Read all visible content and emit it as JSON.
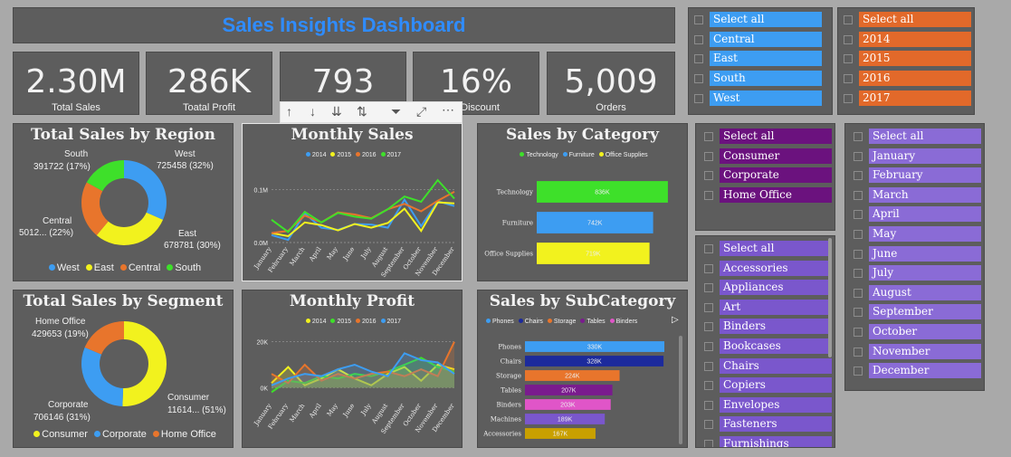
{
  "dashboard_title": "Sales Insights Dashboard",
  "kpis": [
    {
      "value": "2.30M",
      "label": "Total Sales"
    },
    {
      "value": "286K",
      "label": "Toatal Profit"
    },
    {
      "value": "793",
      "label": "s"
    },
    {
      "value": "16%",
      "label": "g Discount"
    },
    {
      "value": "5,009",
      "label": "Orders"
    }
  ],
  "toolbar": {
    "icons": [
      "arrow-up-icon",
      "arrow-down-icon",
      "double-arrow-down-icon",
      "expand-hierarchy-icon",
      "filter-icon",
      "focus-mode-icon",
      "more-options-icon"
    ]
  },
  "slicers": {
    "region": {
      "color": "#3d9df2",
      "items": [
        "Select all",
        "Central",
        "East",
        "South",
        "West"
      ]
    },
    "year": {
      "color": "#e2692a",
      "items": [
        "Select all",
        "2014",
        "2015",
        "2016",
        "2017"
      ]
    },
    "segment": {
      "color": "#6b127e",
      "items": [
        "Select all",
        "Consumer",
        "Corporate",
        "Home Office"
      ]
    },
    "month": {
      "color": "#8a6bd6",
      "items": [
        "Select all",
        "January",
        "February",
        "March",
        "April",
        "May",
        "June",
        "July",
        "August",
        "September",
        "October",
        "November",
        "December"
      ]
    },
    "subcategory": {
      "color": "#7a57cc",
      "items": [
        "Select all",
        "Accessories",
        "Appliances",
        "Art",
        "Binders",
        "Bookcases",
        "Chairs",
        "Copiers",
        "Envelopes",
        "Fasteners",
        "Furnishings"
      ]
    }
  },
  "charts": {
    "region": {
      "title": "Total Sales by Region",
      "legend": [
        "West",
        "East",
        "Central",
        "South"
      ],
      "labels": {
        "west": "West",
        "west_v": "725458 (32%)",
        "east": "East",
        "east_v": "678781 (30%)",
        "central": "Central",
        "central_v": "5012... (22%)",
        "south": "South",
        "south_v": "391722 (17%)"
      }
    },
    "monthly_sales": {
      "title": "Monthly Sales",
      "legend": [
        "2014",
        "2015",
        "2016",
        "2017"
      ],
      "y_ticks": [
        "0.1M",
        "0.0M"
      ]
    },
    "category": {
      "title": "Sales by Category",
      "legend": [
        "Technology",
        "Furniture",
        "Office Supplies"
      ]
    },
    "segment": {
      "title": "Total Sales by Segment",
      "legend": [
        "Consumer",
        "Corporate",
        "Home Office"
      ],
      "labels": {
        "home": "Home Office",
        "home_v": "429653 (19%)",
        "corp": "Corporate",
        "corp_v": "706146 (31%)",
        "cons": "Consumer",
        "cons_v": "11614... (51%)"
      }
    },
    "monthly_profit": {
      "title": "Monthly Profit",
      "legend": [
        "2014",
        "2015",
        "2016",
        "2017"
      ],
      "y_ticks": [
        "20K",
        "0K"
      ]
    },
    "subcategory": {
      "title": "Sales by SubCategory",
      "legend": [
        "Phones",
        "Chairs",
        "Storage",
        "Tables",
        "Binders"
      ]
    }
  },
  "chart_data": [
    {
      "type": "pie",
      "title": "Total Sales by Region",
      "categories": [
        "West",
        "East",
        "Central",
        "South"
      ],
      "values": [
        725458,
        678781,
        501240,
        391722
      ],
      "colors": [
        "#3d9df2",
        "#f2f21e",
        "#e8752c",
        "#3ee02a"
      ]
    },
    {
      "type": "line",
      "title": "Monthly Sales",
      "x": [
        "January",
        "February",
        "March",
        "April",
        "May",
        "June",
        "July",
        "August",
        "September",
        "October",
        "November",
        "December"
      ],
      "ylim": [
        0,
        0.13
      ],
      "series": [
        {
          "name": "2014",
          "color": "#3d9df2",
          "values": [
            0.014,
            0.005,
            0.055,
            0.028,
            0.024,
            0.035,
            0.034,
            0.028,
            0.081,
            0.031,
            0.078,
            0.069
          ]
        },
        {
          "name": "2015",
          "color": "#f2f21e",
          "values": [
            0.018,
            0.012,
            0.038,
            0.033,
            0.023,
            0.035,
            0.028,
            0.037,
            0.064,
            0.022,
            0.076,
            0.074
          ]
        },
        {
          "name": "2016",
          "color": "#e8752c",
          "values": [
            0.018,
            0.022,
            0.051,
            0.038,
            0.057,
            0.053,
            0.046,
            0.063,
            0.073,
            0.059,
            0.079,
            0.096
          ]
        },
        {
          "name": "2017",
          "color": "#3ee02a",
          "values": [
            0.043,
            0.02,
            0.058,
            0.038,
            0.056,
            0.049,
            0.045,
            0.063,
            0.087,
            0.077,
            0.118,
            0.083
          ]
        }
      ]
    },
    {
      "type": "bar",
      "title": "Sales by Category",
      "categories": [
        "Technology",
        "Furniture",
        "Office Supplies"
      ],
      "values": [
        836,
        742,
        719
      ],
      "value_labels": [
        "836K",
        "742K",
        "719K"
      ],
      "colors": [
        "#3ee02a",
        "#3d9df2",
        "#f2f21e"
      ],
      "xlim": [
        0,
        900
      ]
    },
    {
      "type": "pie",
      "title": "Total Sales by Segment",
      "categories": [
        "Consumer",
        "Corporate",
        "Home Office"
      ],
      "values": [
        1161401,
        706146,
        429653
      ],
      "colors": [
        "#f2f21e",
        "#3d9df2",
        "#e8752c"
      ]
    },
    {
      "type": "area",
      "title": "Monthly Profit",
      "x": [
        "January",
        "February",
        "March",
        "April",
        "May",
        "June",
        "July",
        "August",
        "September",
        "October",
        "November",
        "December"
      ],
      "ylim": [
        -5,
        25
      ],
      "series": [
        {
          "name": "2014",
          "color": "#f2f21e",
          "values": [
            2,
            9,
            1,
            4,
            8,
            4,
            1,
            6,
            9,
            3,
            10,
            8
          ]
        },
        {
          "name": "2015",
          "color": "#3ee02a",
          "values": [
            -2,
            3,
            2,
            5,
            4,
            6,
            5,
            7,
            10,
            13,
            9,
            7
          ]
        },
        {
          "name": "2016",
          "color": "#e8752c",
          "values": [
            6,
            2,
            10,
            3,
            6,
            4,
            6,
            7,
            5,
            8,
            5,
            20
          ]
        },
        {
          "name": "2017",
          "color": "#3d9df2",
          "values": [
            1,
            4,
            6,
            5,
            8,
            10,
            7,
            5,
            15,
            12,
            11,
            6
          ]
        }
      ]
    },
    {
      "type": "bar",
      "title": "Sales by SubCategory",
      "categories": [
        "Phones",
        "Chairs",
        "Storage",
        "Tables",
        "Binders",
        "Machines",
        "Accessories"
      ],
      "values": [
        330,
        328,
        224,
        207,
        203,
        189,
        167
      ],
      "value_labels": [
        "330K",
        "328K",
        "224K",
        "207K",
        "203K",
        "189K",
        "167K"
      ],
      "colors": [
        "#3d9df2",
        "#1c2a9c",
        "#e8752c",
        "#7a1b8e",
        "#e055c8",
        "#7a57cc",
        "#c9a000"
      ],
      "xlim": [
        0,
        360
      ]
    }
  ]
}
